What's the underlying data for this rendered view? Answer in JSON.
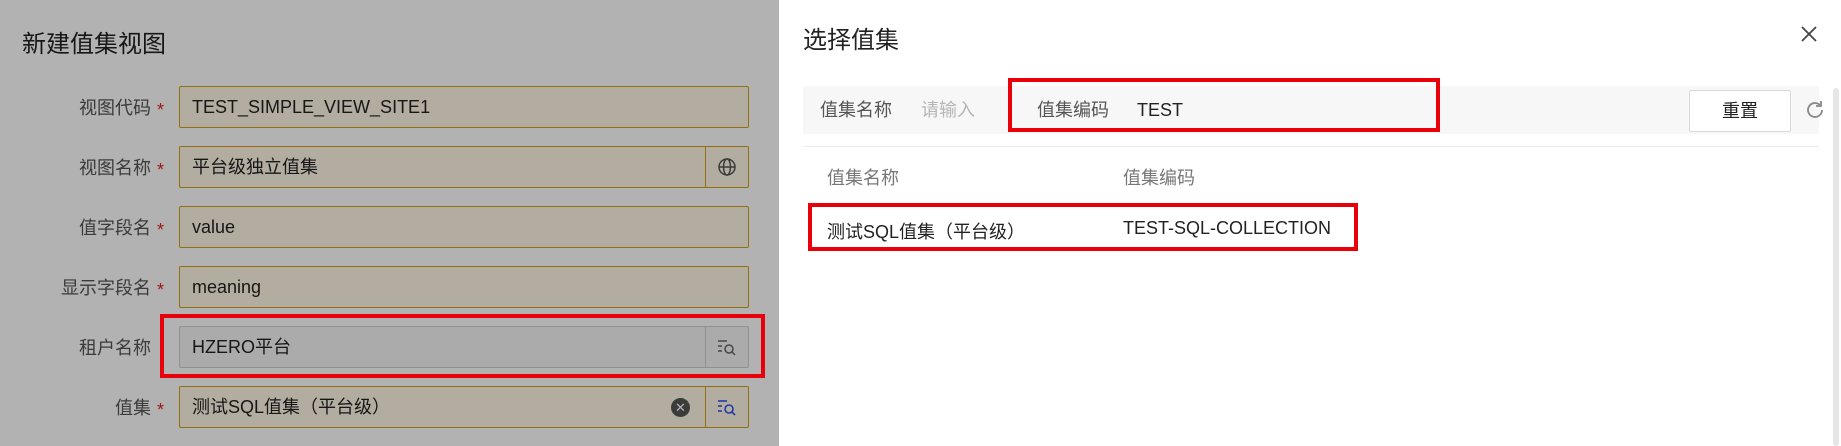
{
  "form": {
    "title": "新建值集视图",
    "required_mark": "*",
    "fields": {
      "view_code": {
        "label": "视图代码",
        "value": "TEST_SIMPLE_VIEW_SITE1"
      },
      "view_name": {
        "label": "视图名称",
        "value": "平台级独立值集"
      },
      "value_field": {
        "label": "值字段名",
        "value": "value"
      },
      "display_field": {
        "label": "显示字段名",
        "value": "meaning"
      },
      "tenant": {
        "label": "租户名称",
        "value": "HZERO平台"
      },
      "value_set": {
        "label": "值集",
        "value": "测试SQL值集（平台级）"
      }
    }
  },
  "modal": {
    "title": "选择值集",
    "query": {
      "name_label": "值集名称",
      "name_placeholder": "请输入",
      "code_label": "值集编码",
      "code_value": "TEST",
      "reset_label": "重置"
    },
    "table": {
      "headers": [
        "值集名称",
        "值集编码"
      ],
      "rows": [
        {
          "name": "测试SQL值集（平台级）",
          "code": "TEST-SQL-COLLECTION"
        }
      ]
    }
  },
  "icons": {
    "globe": "globe-icon",
    "lov_search": "lov-search-icon",
    "clear": "clear-icon",
    "close": "close-icon",
    "refresh": "refresh-icon"
  },
  "colors": {
    "highlight": "#e8000b",
    "required": "#e2231a",
    "field_border": "#d4a017",
    "field_bg": "#fff8e6"
  }
}
